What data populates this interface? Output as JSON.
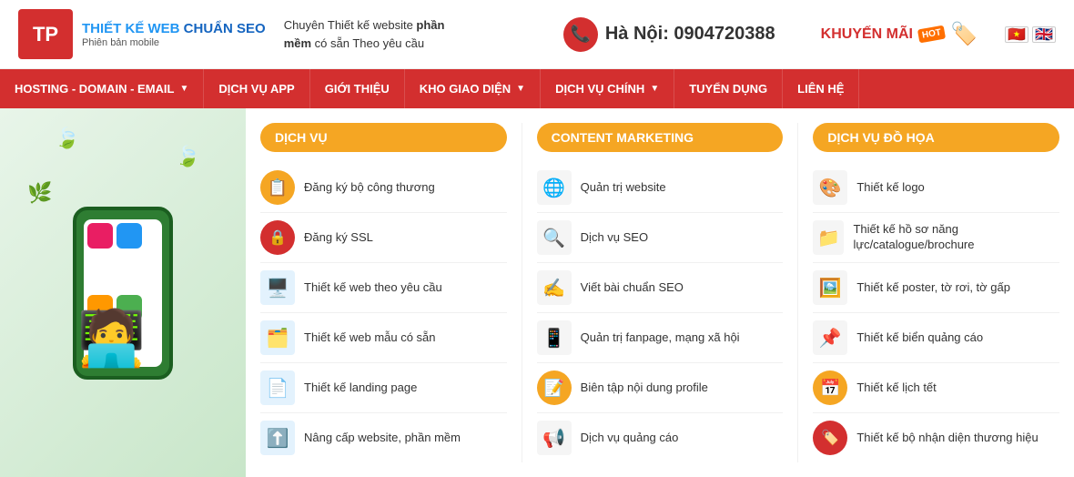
{
  "header": {
    "logo_short": "TP",
    "brand_name1": "THIẾT KẾ WEB ",
    "brand_name_blue": "CHUẨN SEO",
    "brand_sub": "Phiên bản mobile",
    "tagline": "Chuyên Thiết kế website ",
    "tagline_bold": "phần mềm",
    "tagline_rest": " có sẵn Theo yêu cầu",
    "city_label": "Hà Nội: 0904720388",
    "promo_label": "KHUYẾN MÃI",
    "promo_badge": "HOT"
  },
  "nav": {
    "items": [
      {
        "label": "HOSTING - DOMAIN - EMAIL",
        "has_dropdown": true
      },
      {
        "label": "DỊCH VỤ APP",
        "has_dropdown": false
      },
      {
        "label": "GIỚI THIỆU",
        "has_dropdown": false
      },
      {
        "label": "KHO GIAO DIỆN",
        "has_dropdown": true
      },
      {
        "label": "DỊCH VỤ CHÍNH",
        "has_dropdown": true
      },
      {
        "label": "TUYỂN DỤNG",
        "has_dropdown": false
      },
      {
        "label": "LIÊN HỆ",
        "has_dropdown": false
      }
    ]
  },
  "columns": [
    {
      "header": "DỊCH VỤ",
      "items": [
        {
          "icon_type": "yellow_circle",
          "icon": "📋",
          "label": "Đăng ký bộ công thương"
        },
        {
          "icon_type": "red_circle",
          "icon": "🔒",
          "label": "Đăng ký SSL"
        },
        {
          "icon_type": "rect_blue",
          "icon": "🖥️",
          "label": "Thiết kế web theo yêu cầu"
        },
        {
          "icon_type": "rect_blue",
          "icon": "🗂️",
          "label": "Thiết kế web mẫu có sẵn"
        },
        {
          "icon_type": "rect_blue",
          "icon": "📄",
          "label": "Thiết kế landing page"
        },
        {
          "icon_type": "rect_blue",
          "icon": "⬆️",
          "label": "Nâng cấp website, phần mềm"
        }
      ]
    },
    {
      "header": "CONTENT MARKETING",
      "items": [
        {
          "icon_type": "rect_gray",
          "icon": "🌐",
          "label": "Quản trị website"
        },
        {
          "icon_type": "rect_gray",
          "icon": "🔍",
          "label": "Dịch vụ SEO"
        },
        {
          "icon_type": "rect_gray",
          "icon": "✍️",
          "label": "Viết bài chuẩn SEO"
        },
        {
          "icon_type": "rect_gray",
          "icon": "📱",
          "label": "Quản trị fanpage, mạng xã hội"
        },
        {
          "icon_type": "yellow_circle",
          "icon": "📝",
          "label": "Biên tập nội dung profile"
        },
        {
          "icon_type": "rect_gray",
          "icon": "📢",
          "label": "Dịch vụ quảng cáo"
        }
      ]
    },
    {
      "header": "DỊCH VỤ ĐỒ HỌA",
      "items": [
        {
          "icon_type": "rect_gray",
          "icon": "🎨",
          "label": "Thiết kế logo"
        },
        {
          "icon_type": "rect_gray",
          "icon": "📁",
          "label": "Thiết kế hồ sơ năng lực/catalogue/brochure"
        },
        {
          "icon_type": "rect_gray",
          "icon": "🖼️",
          "label": "Thiết kế poster, tờ rơi, tờ gấp"
        },
        {
          "icon_type": "rect_gray",
          "icon": "📌",
          "label": "Thiết kế biển quảng cáo"
        },
        {
          "icon_type": "yellow_circle",
          "icon": "📅",
          "label": "Thiết kế lịch tết"
        },
        {
          "icon_type": "red_circle",
          "icon": "🏷️",
          "label": "Thiết kế bộ nhận diện thương hiệu"
        }
      ]
    }
  ]
}
